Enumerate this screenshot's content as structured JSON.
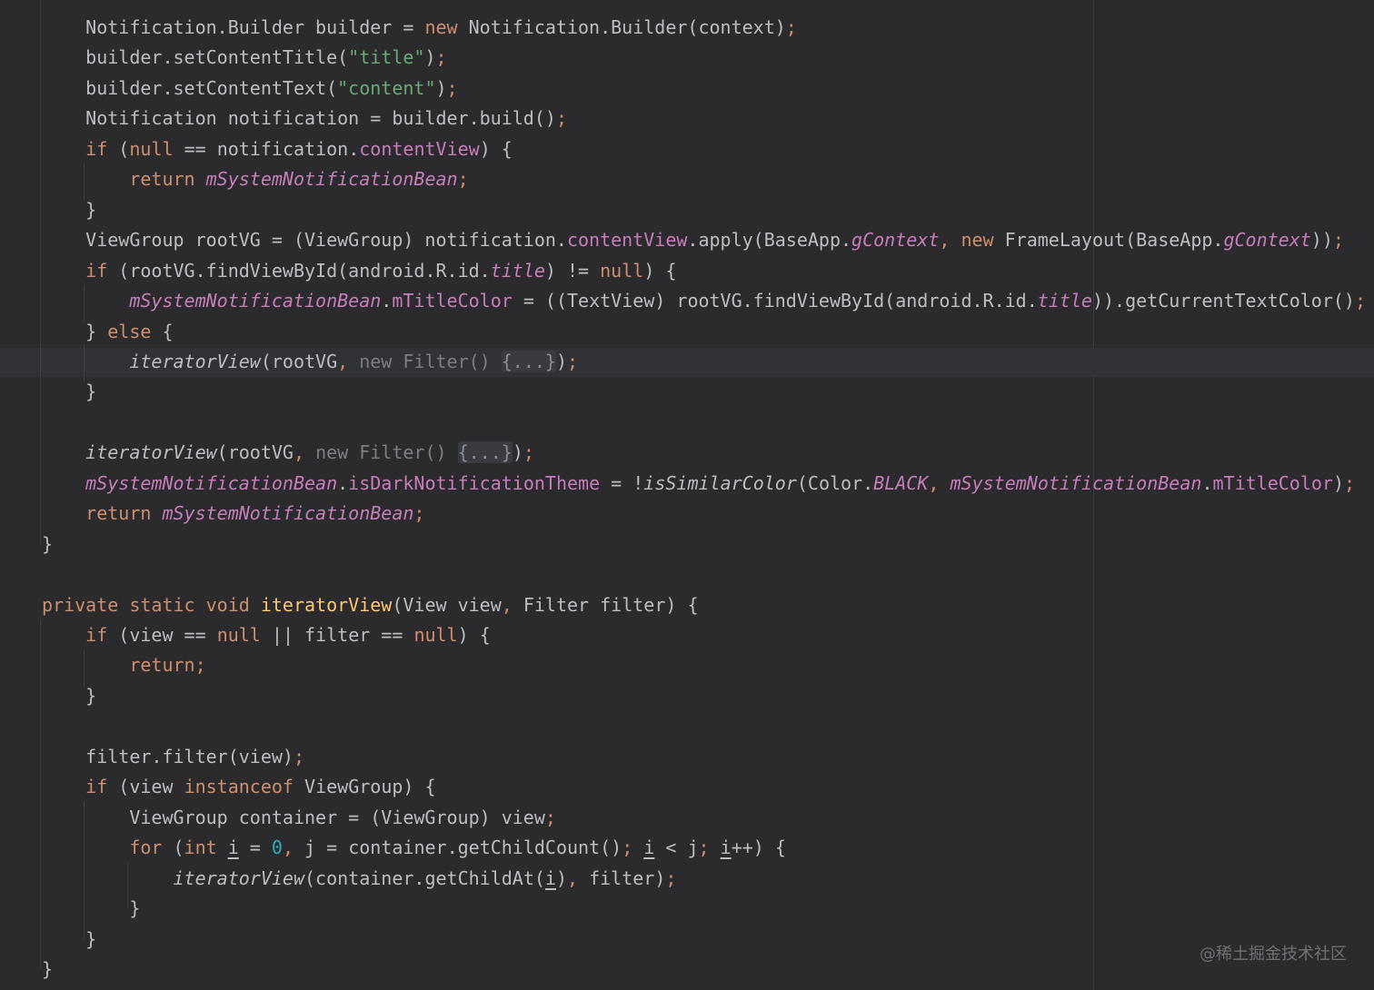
{
  "code_lines": [
    [
      {
        "t": "    Notification.Builder builder = ",
        "c": ""
      },
      {
        "t": "new",
        "c": "kw"
      },
      {
        "t": " Notification.Builder(context)",
        "c": ""
      },
      {
        "t": ";",
        "c": "kw"
      }
    ],
    [
      {
        "t": "    builder.setContentTitle(",
        "c": ""
      },
      {
        "t": "\"title\"",
        "c": "str"
      },
      {
        "t": ")",
        "c": ""
      },
      {
        "t": ";",
        "c": "kw"
      }
    ],
    [
      {
        "t": "    builder.setContentText(",
        "c": ""
      },
      {
        "t": "\"content\"",
        "c": "str"
      },
      {
        "t": ")",
        "c": ""
      },
      {
        "t": ";",
        "c": "kw"
      }
    ],
    [
      {
        "t": "    Notification notification = builder.build()",
        "c": ""
      },
      {
        "t": ";",
        "c": "kw"
      }
    ],
    [
      {
        "t": "    ",
        "c": ""
      },
      {
        "t": "if",
        "c": "kw"
      },
      {
        "t": " (",
        "c": ""
      },
      {
        "t": "null",
        "c": "kw"
      },
      {
        "t": " == notification.",
        "c": ""
      },
      {
        "t": "contentView",
        "c": "field"
      },
      {
        "t": ") {",
        "c": ""
      }
    ],
    [
      {
        "t": "        ",
        "c": ""
      },
      {
        "t": "return",
        "c": "kw"
      },
      {
        "t": " ",
        "c": ""
      },
      {
        "t": "mSystemNotificationBean",
        "c": "static"
      },
      {
        "t": ";",
        "c": "kw"
      }
    ],
    [
      {
        "t": "    }",
        "c": ""
      }
    ],
    [
      {
        "t": "    ViewGroup rootVG = (ViewGroup) notification.",
        "c": ""
      },
      {
        "t": "contentView",
        "c": "field"
      },
      {
        "t": ".apply(BaseApp.",
        "c": ""
      },
      {
        "t": "gContext",
        "c": "static"
      },
      {
        "t": ", ",
        "c": "kw"
      },
      {
        "t": "new",
        "c": "kw"
      },
      {
        "t": " FrameLayout(BaseApp.",
        "c": ""
      },
      {
        "t": "gContext",
        "c": "static"
      },
      {
        "t": "))",
        "c": ""
      },
      {
        "t": ";",
        "c": "kw"
      }
    ],
    [
      {
        "t": "    ",
        "c": ""
      },
      {
        "t": "if",
        "c": "kw"
      },
      {
        "t": " (rootVG.findViewById(android.R.id.",
        "c": ""
      },
      {
        "t": "title",
        "c": "static"
      },
      {
        "t": ") != ",
        "c": ""
      },
      {
        "t": "null",
        "c": "kw"
      },
      {
        "t": ") {",
        "c": ""
      }
    ],
    [
      {
        "t": "        ",
        "c": ""
      },
      {
        "t": "mSystemNotificationBean",
        "c": "static"
      },
      {
        "t": ".",
        "c": ""
      },
      {
        "t": "mTitleColor",
        "c": "field"
      },
      {
        "t": " = ((TextView) rootVG.findViewById(android.R.id.",
        "c": ""
      },
      {
        "t": "title",
        "c": "static"
      },
      {
        "t": ")).getCurrentTextColor()",
        "c": ""
      },
      {
        "t": ";",
        "c": "kw"
      }
    ],
    [
      {
        "t": "    } ",
        "c": ""
      },
      {
        "t": "else",
        "c": "kw"
      },
      {
        "t": " {",
        "c": ""
      }
    ],
    [
      {
        "t": "        ",
        "c": ""
      },
      {
        "t": "iteratorView",
        "c": "italic"
      },
      {
        "t": "(rootVG",
        "c": ""
      },
      {
        "t": ", ",
        "c": "kw"
      },
      {
        "t": "new Filter() ",
        "c": "muted"
      },
      {
        "t": "{...}",
        "c": "fold"
      },
      {
        "t": ")",
        "c": ""
      },
      {
        "t": ";",
        "c": "kw"
      }
    ],
    [
      {
        "t": "    }",
        "c": ""
      }
    ],
    [
      {
        "t": "",
        "c": ""
      }
    ],
    [
      {
        "t": "    ",
        "c": ""
      },
      {
        "t": "iteratorView",
        "c": "italic"
      },
      {
        "t": "(rootVG",
        "c": ""
      },
      {
        "t": ", ",
        "c": "kw"
      },
      {
        "t": "new Filter() ",
        "c": "muted"
      },
      {
        "t": "{...}",
        "c": "fold"
      },
      {
        "t": ")",
        "c": ""
      },
      {
        "t": ";",
        "c": "kw"
      }
    ],
    [
      {
        "t": "    ",
        "c": ""
      },
      {
        "t": "mSystemNotificationBean",
        "c": "static"
      },
      {
        "t": ".",
        "c": ""
      },
      {
        "t": "isDarkNotificationTheme",
        "c": "field"
      },
      {
        "t": " = !",
        "c": ""
      },
      {
        "t": "isSimilarColor",
        "c": "italic"
      },
      {
        "t": "(Color.",
        "c": ""
      },
      {
        "t": "BLACK",
        "c": "static"
      },
      {
        "t": ", ",
        "c": "kw"
      },
      {
        "t": "mSystemNotificationBean",
        "c": "static"
      },
      {
        "t": ".",
        "c": ""
      },
      {
        "t": "mTitleColor",
        "c": "field"
      },
      {
        "t": ")",
        "c": ""
      },
      {
        "t": ";",
        "c": "kw"
      }
    ],
    [
      {
        "t": "    ",
        "c": ""
      },
      {
        "t": "return",
        "c": "kw"
      },
      {
        "t": " ",
        "c": ""
      },
      {
        "t": "mSystemNotificationBean",
        "c": "static"
      },
      {
        "t": ";",
        "c": "kw"
      }
    ],
    [
      {
        "t": "}",
        "c": ""
      }
    ],
    [
      {
        "t": "",
        "c": ""
      }
    ],
    [
      {
        "t": "private static void",
        "c": "kw"
      },
      {
        "t": " ",
        "c": ""
      },
      {
        "t": "iteratorView",
        "c": "decl"
      },
      {
        "t": "(View view",
        "c": ""
      },
      {
        "t": ", ",
        "c": "kw"
      },
      {
        "t": "Filter filter) {",
        "c": ""
      }
    ],
    [
      {
        "t": "    ",
        "c": ""
      },
      {
        "t": "if",
        "c": "kw"
      },
      {
        "t": " (view == ",
        "c": ""
      },
      {
        "t": "null",
        "c": "kw"
      },
      {
        "t": " || filter == ",
        "c": ""
      },
      {
        "t": "null",
        "c": "kw"
      },
      {
        "t": ") {",
        "c": ""
      }
    ],
    [
      {
        "t": "        ",
        "c": ""
      },
      {
        "t": "return;",
        "c": "kw"
      }
    ],
    [
      {
        "t": "    }",
        "c": ""
      }
    ],
    [
      {
        "t": "",
        "c": ""
      }
    ],
    [
      {
        "t": "    filter.filter(view)",
        "c": ""
      },
      {
        "t": ";",
        "c": "kw"
      }
    ],
    [
      {
        "t": "    ",
        "c": ""
      },
      {
        "t": "if",
        "c": "kw"
      },
      {
        "t": " (view ",
        "c": ""
      },
      {
        "t": "instanceof",
        "c": "kw"
      },
      {
        "t": " ViewGroup) {",
        "c": ""
      }
    ],
    [
      {
        "t": "        ViewGroup container = (ViewGroup) view",
        "c": ""
      },
      {
        "t": ";",
        "c": "kw"
      }
    ],
    [
      {
        "t": "        ",
        "c": ""
      },
      {
        "t": "for",
        "c": "kw"
      },
      {
        "t": " (",
        "c": ""
      },
      {
        "t": "int",
        "c": "kw"
      },
      {
        "t": " ",
        "c": ""
      },
      {
        "t": "i",
        "c": "underline"
      },
      {
        "t": " = ",
        "c": ""
      },
      {
        "t": "0",
        "c": "num"
      },
      {
        "t": ", ",
        "c": "kw"
      },
      {
        "t": "j = container.getChildCount()",
        "c": ""
      },
      {
        "t": "; ",
        "c": "kw"
      },
      {
        "t": "i",
        "c": "underline"
      },
      {
        "t": " < j",
        "c": ""
      },
      {
        "t": "; ",
        "c": "kw"
      },
      {
        "t": "i",
        "c": "underline"
      },
      {
        "t": "++) {",
        "c": ""
      }
    ],
    [
      {
        "t": "            ",
        "c": ""
      },
      {
        "t": "iteratorView",
        "c": "italic"
      },
      {
        "t": "(container.getChildAt(",
        "c": ""
      },
      {
        "t": "i",
        "c": "underline"
      },
      {
        "t": ")",
        "c": ""
      },
      {
        "t": ", ",
        "c": "kw"
      },
      {
        "t": "filter)",
        "c": ""
      },
      {
        "t": ";",
        "c": "kw"
      }
    ],
    [
      {
        "t": "        }",
        "c": ""
      }
    ],
    [
      {
        "t": "    }",
        "c": ""
      }
    ],
    [
      {
        "t": "}",
        "c": ""
      }
    ]
  ],
  "watermark": "@稀土掘金技术社区"
}
